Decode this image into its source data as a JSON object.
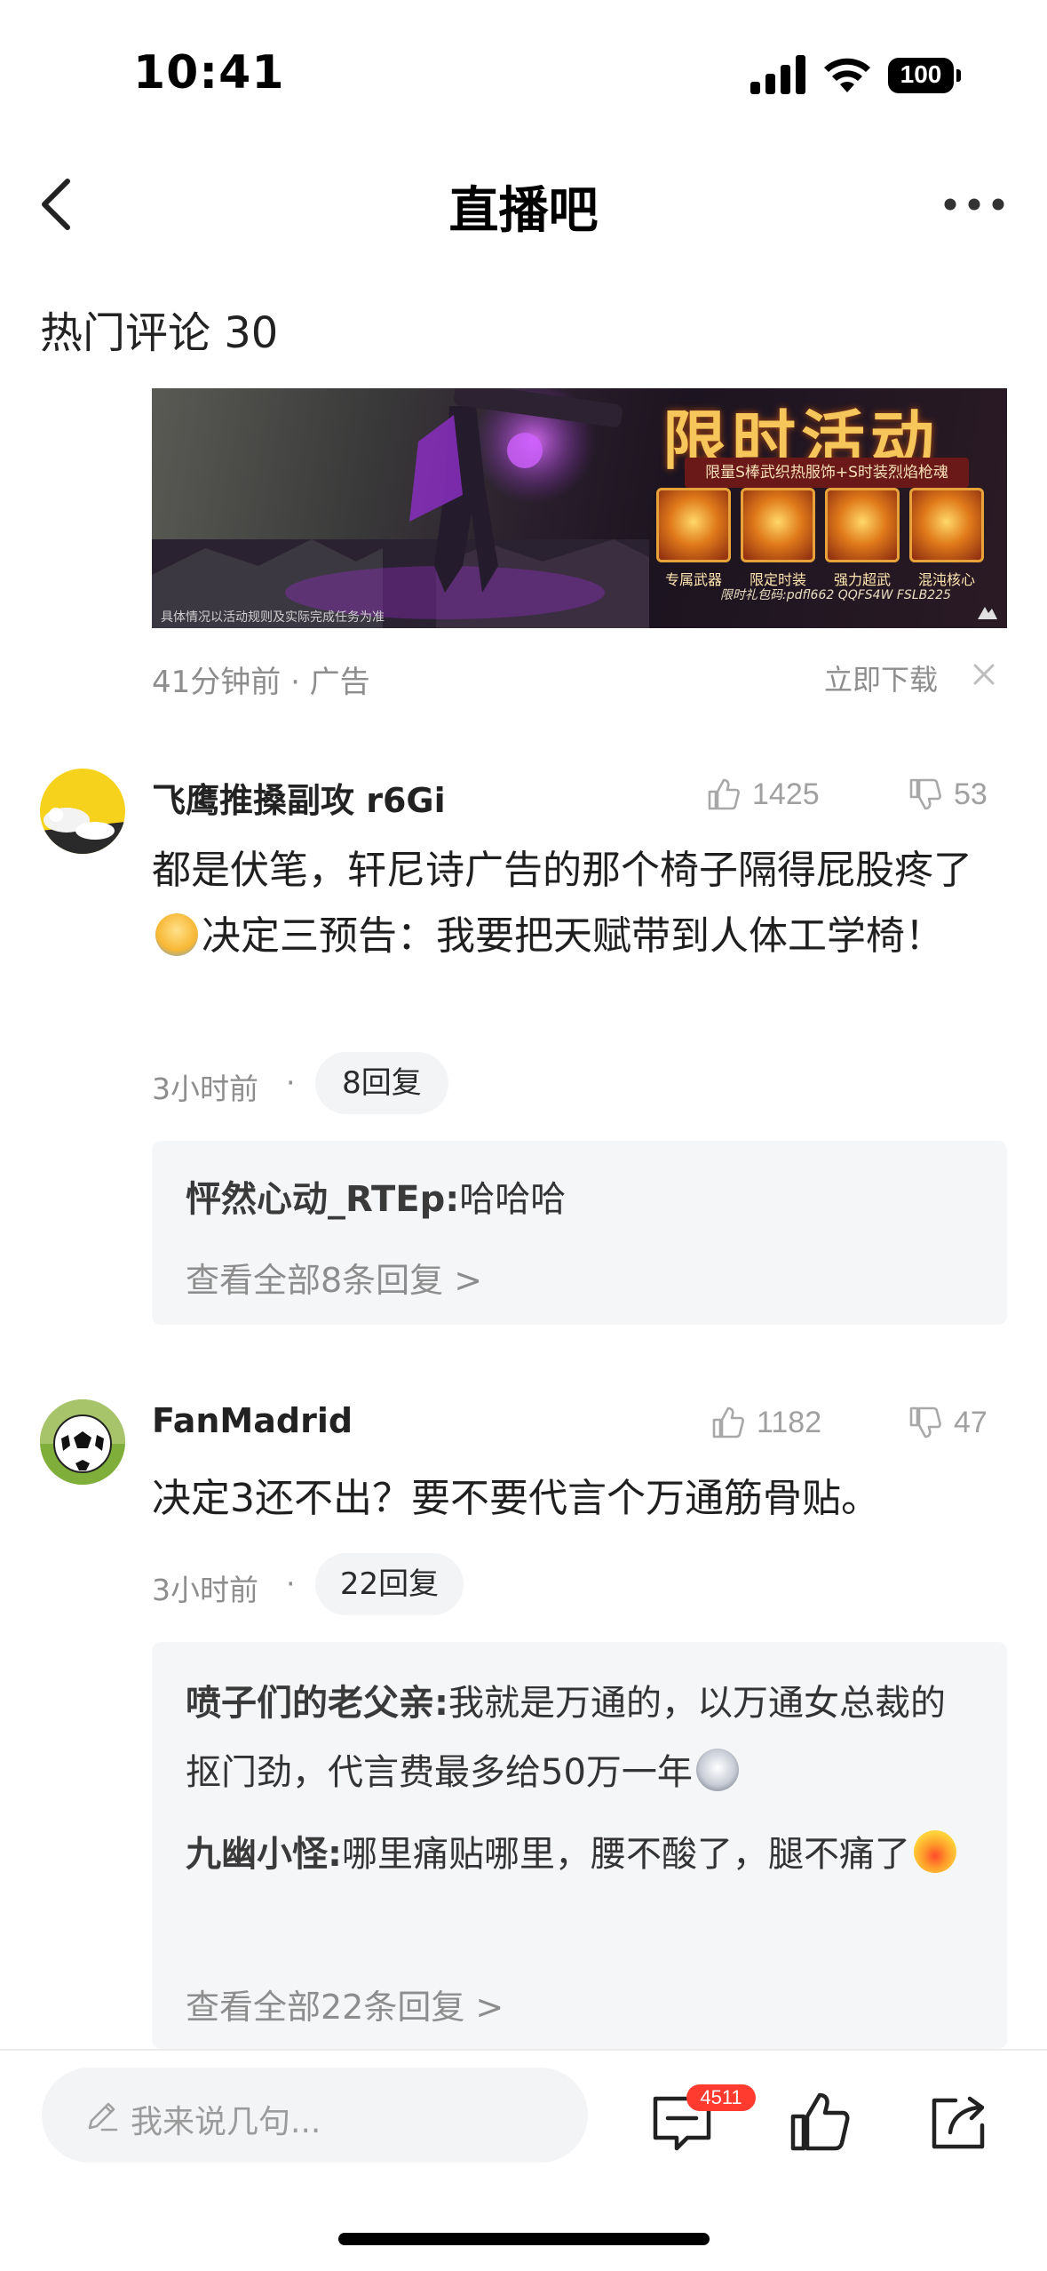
{
  "status_bar": {
    "time": "10:41",
    "battery": "100"
  },
  "nav": {
    "title": "直播吧"
  },
  "section": {
    "title": "热门评论 30"
  },
  "ad": {
    "headline": "限时活动",
    "subtitle": "限量S棒武织热服饰+S时装烈焰枪魂",
    "items": [
      "专属武器",
      "限定时装",
      "强力超武",
      "混沌核心"
    ],
    "code": "限时礼包码:pdfl662 QQFS4W FSLB225",
    "disclaimer": "具体情况以活动规则及实际完成任务为准",
    "meta": "41分钟前 · 广告",
    "download": "立即下载"
  },
  "comments": [
    {
      "username": "飞鹰推搡副攻 r6Gi",
      "likes": "1425",
      "dislikes": "53",
      "text_a": "都是伏笔，轩尼诗广告的那个椅子隔得屁股疼了",
      "text_b": "决定三预告：我要把天赋带到人体工学椅！",
      "time": "3小时前",
      "reply_count": "8回复",
      "replies": [
        {
          "user": "怦然心动_RTEp",
          "sep": ":",
          "text": "哈哈哈"
        }
      ],
      "view_all": "查看全部8条回复 >"
    },
    {
      "username": "FanMadrid",
      "likes": "1182",
      "dislikes": "47",
      "text": "决定3还不出？要不要代言个万通筋骨贴。",
      "time": "3小时前",
      "reply_count": "22回复",
      "replies": [
        {
          "user": "喷子们的老父亲",
          "sep": ":",
          "text": "我就是万通的，以万通女总裁的抠门劲，代言费最多给50万一年"
        },
        {
          "user": "九幽小怪",
          "sep": ":",
          "text": "哪里痛贴哪里，腰不酸了，腿不痛了"
        }
      ],
      "view_all": "查看全部22条回复 >"
    }
  ],
  "bottom_bar": {
    "placeholder": "我来说几句...",
    "comment_badge": "4511"
  },
  "colors": {
    "badge": "#ff3b30",
    "reply_bg": "#f5f6f8",
    "muted_text": "#8d8d8d"
  }
}
